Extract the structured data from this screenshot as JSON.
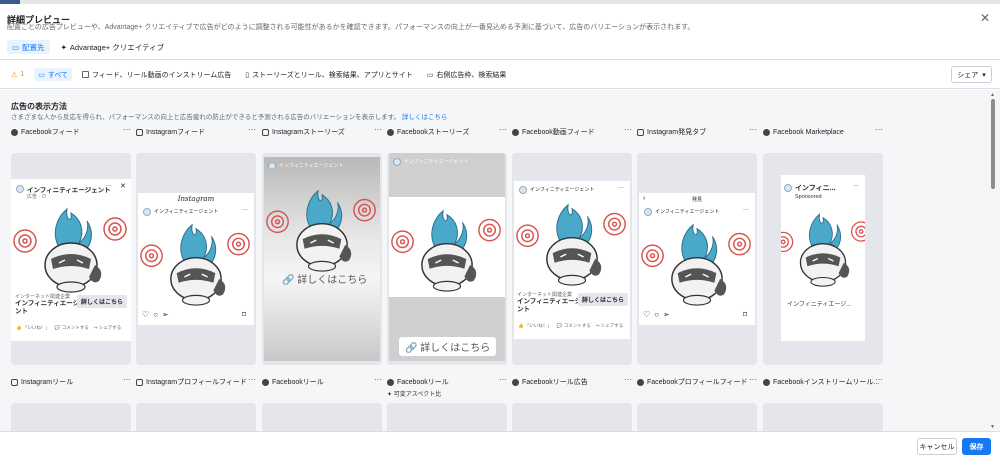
{
  "header": {
    "title": "詳細プレビュー",
    "subtitle": "配置ごとの広告プレビューや、Advantage+ クリエイティブで広告がどのように調整される可能性があるかを確認できます。パフォーマンスの向上が一番見込める予測に基づいて、広告のバリエーションが表示されます。",
    "tabs": [
      {
        "label": "配置先",
        "icon": "placement-icon"
      },
      {
        "label": "Advantage+ クリエイティブ",
        "icon": "sparkle-icon"
      }
    ]
  },
  "toolbar": {
    "warning_count": "1",
    "filters": [
      {
        "label": "すべて"
      },
      {
        "label": "フィード、リール動画のインストリーム広告"
      },
      {
        "label": "ストーリーズとリール、検索結果、アプリとサイト"
      },
      {
        "label": "右側広告枠、検索結果"
      }
    ],
    "share_label": "シェア"
  },
  "section": {
    "title": "広告の表示方法",
    "description": "さまざまな人から反応を得られ、パフォーマンスの向上と広告疲れの防止ができると予測される広告のバリエーションを表示します。",
    "link": "詳しくはこちら"
  },
  "placements_row1": [
    {
      "label": "Facebookフィード",
      "platform": "facebook"
    },
    {
      "label": "Instagramフィード",
      "platform": "instagram"
    },
    {
      "label": "Instagramストーリーズ",
      "platform": "instagram"
    },
    {
      "label": "Facebookストーリーズ",
      "platform": "facebook"
    },
    {
      "label": "Facebook動画フィード",
      "platform": "facebook"
    },
    {
      "label": "Instagram発見タブ",
      "platform": "instagram"
    },
    {
      "label": "Facebook Marketplace",
      "platform": "facebook"
    }
  ],
  "placements_row2": [
    {
      "label": "Instagramリール",
      "platform": "instagram"
    },
    {
      "label": "Instagramプロフィールフィード",
      "platform": "instagram"
    },
    {
      "label": "Facebookリール",
      "platform": "facebook"
    },
    {
      "label": "Facebookリール",
      "platform": "facebook",
      "tag": "可変アスペクト比"
    },
    {
      "label": "Facebookリール広告",
      "platform": "facebook"
    },
    {
      "label": "Facebookプロフィールフィード",
      "platform": "facebook"
    },
    {
      "label": "Facebookインストリームリール...",
      "platform": "facebook"
    }
  ],
  "ad": {
    "page_name": "インフィニティエージェント",
    "sponsored": "広告 · ⊙",
    "sponsored_en": "Sponsored",
    "cta": "詳しくはこちら",
    "category": "インターネット関連企業",
    "link_title": "インフィニティエージェ\nント",
    "link_title_short": "インフィニティエージ...",
    "marketplace_name": "インフィニ...",
    "instagram_logo": "Instagram",
    "explore_header": "発見",
    "reactions": [
      "「いいね！」",
      "コメントする",
      "シェアする"
    ],
    "story_link": "詳しくはこちら"
  },
  "footer": {
    "cancel": "キャンセル",
    "save": "保存"
  },
  "colors": {
    "accent": "#1877f2",
    "warning": "#e68a00",
    "mascot_flame": "#4aa8c8",
    "swirl": "#d9534f"
  }
}
